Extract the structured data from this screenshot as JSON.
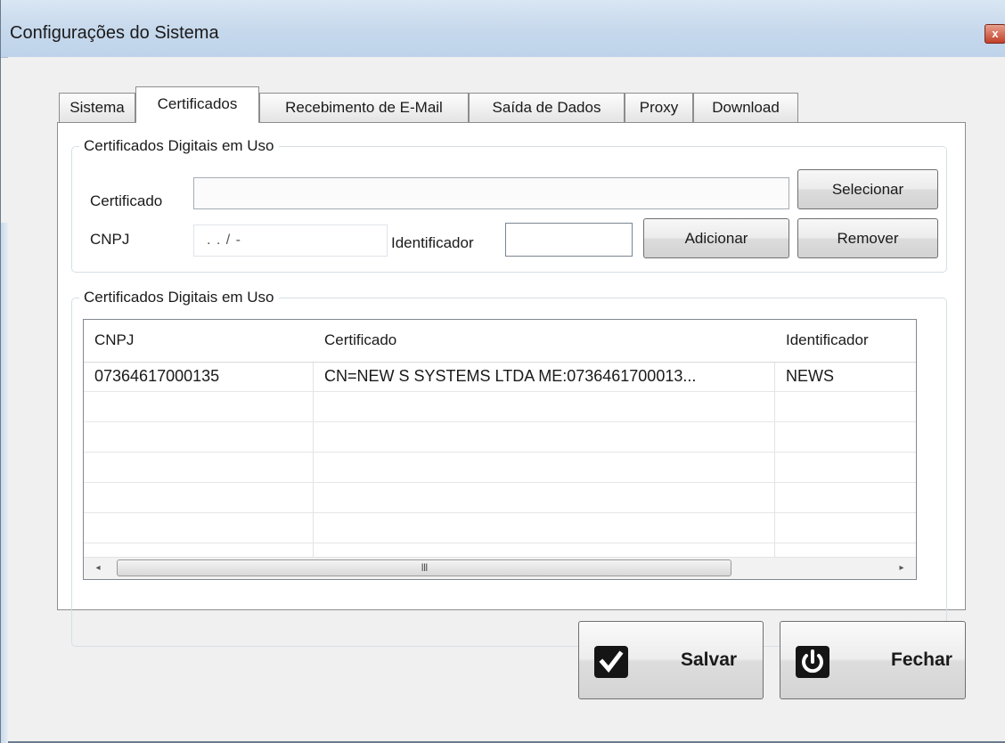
{
  "window": {
    "title": "Configurações do Sistema",
    "close_glyph": "x"
  },
  "tabs": [
    {
      "label": "Sistema"
    },
    {
      "label": "Certificados"
    },
    {
      "label": "Recebimento de E-Mail"
    },
    {
      "label": "Saída de Dados"
    },
    {
      "label": "Proxy"
    },
    {
      "label": "Download"
    }
  ],
  "active_tab": "Certificados",
  "input_group": {
    "legend": "Certificados Digitais em Uso",
    "certificado_label": "Certificado",
    "certificado_value": "",
    "cnpj_label": "CNPJ",
    "cnpj_mask": ". . / -",
    "identificador_label": "Identificador",
    "identificador_value": "",
    "selecionar_label": "Selecionar",
    "adicionar_label": "Adicionar",
    "remover_label": "Remover"
  },
  "list_group": {
    "legend": "Certificados Digitais em Uso",
    "columns": [
      "CNPJ",
      "Certificado",
      "Identificador"
    ],
    "rows": [
      [
        "07364617000135",
        "CN=NEW S SYSTEMS LTDA ME:0736461700013...",
        "NEWS"
      ]
    ],
    "empty_row_count": 5,
    "scroll_left_glyph": "◂",
    "scroll_right_glyph": "▸",
    "scroll_grip": "III"
  },
  "footer": {
    "save_label": "Salvar",
    "close_label": "Fechar",
    "save_icon": "check-icon",
    "close_icon": "power-icon"
  },
  "colors": {
    "titlebar": "#c6d8ec",
    "window_bg": "#f0f0f0",
    "close_button": "#c2402a",
    "icon_bg": "#151515"
  }
}
